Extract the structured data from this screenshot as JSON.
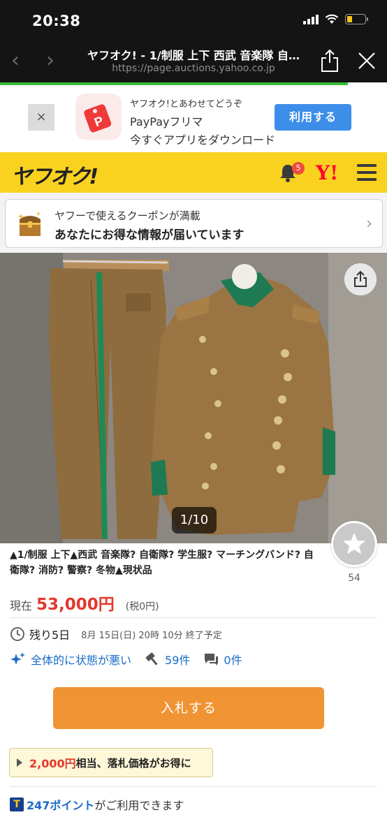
{
  "status": {
    "time": "20:38"
  },
  "browser": {
    "title": "ヤフオク! - 1/制服 上下 西武 音楽隊 自…",
    "url": "https://page.auctions.yahoo.co.jp"
  },
  "promo": {
    "close_glyph": "×",
    "line1": "ヤフオク!とあわせてどうぞ",
    "line2": "PayPayフリマ",
    "line3": "今すぐアプリをダウンロード",
    "button": "利用する"
  },
  "header": {
    "logo": "ヤフオク!",
    "notification_count": "5",
    "yahoo_mark": "Y!"
  },
  "coupon": {
    "line1": "ヤフーで使えるクーポンが満載",
    "line2": "あなたにお得な情報が届いています",
    "chevron": "›"
  },
  "photo": {
    "counter": "1/10"
  },
  "favorite": {
    "count": "54"
  },
  "item": {
    "title": "▲1/制服 上下▲西武 音楽隊? 自衛隊? 学生服? マーチングバンド? 自衛隊? 消防? 警察? 冬物▲現状品",
    "price_label": "現在",
    "price": "53,000円",
    "tax": "(税0円)",
    "remaining": "残り5日",
    "end_time": "8月 15日(日) 20時 10分 終了予定",
    "condition": "全体的に状態が悪い",
    "bids": "59件",
    "questions": "0件"
  },
  "actions": {
    "bid_button": "入札する"
  },
  "deal": {
    "amount": "2,000円",
    "rest": "相当、落札価格がお得に"
  },
  "points": {
    "icon": "T",
    "value": "247ポイント",
    "rest": "がご利用できます"
  },
  "colors": {
    "yahoo_yellow": "#f9d21f",
    "price_red": "#e3382d",
    "link_blue": "#1a6bc8",
    "bid_orange": "#f09433",
    "promo_blue": "#3c8ee8"
  }
}
